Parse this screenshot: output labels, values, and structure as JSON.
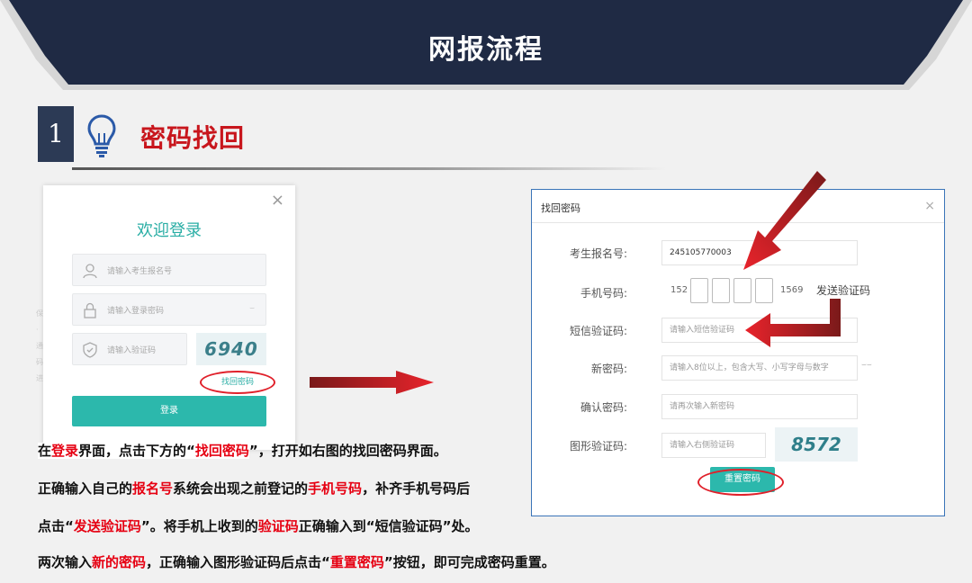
{
  "header": {
    "title": "网报流程"
  },
  "step": {
    "number": "1",
    "title": "密码找回"
  },
  "login_dialog": {
    "close": "×",
    "title": "欢迎登录",
    "id_placeholder": "请输入考生报名号",
    "password_placeholder": "请输入登录密码",
    "captcha_placeholder": "请输入验证码",
    "captcha_image": "6940",
    "forgot_link": "找回密码",
    "login_button": "登录"
  },
  "recover_dialog": {
    "title": "找回密码",
    "close": "×",
    "labels": {
      "reg_no": "考生报名号:",
      "phone": "手机号码:",
      "sms": "短信验证码:",
      "new_pwd": "新密码:",
      "confirm_pwd": "确认密码:",
      "captcha": "图形验证码:"
    },
    "reg_no_value": "245105770003",
    "phone_prefix": "152",
    "phone_suffix": "1569",
    "send_code": "发送验证码",
    "sms_placeholder": "请输入短信验证码",
    "new_pwd_placeholder": "请输入8位以上，包含大写、小写字母与数字",
    "confirm_placeholder": "请再次输入新密码",
    "captcha_placeholder": "请输入右侧验证码",
    "captcha_image": "8572",
    "reset_button": "重置密码"
  },
  "instructions": {
    "l1": [
      "在",
      "登录",
      "界面，点击下方的“",
      "找回密码",
      "”，打开如右图的找回密码界面。"
    ],
    "l2": [
      "正确输入自己的",
      "报名号",
      "系统会出现之前登记的",
      "手机号码",
      "，补齐手机号码后"
    ],
    "l3": [
      "点击“",
      "发送验证码",
      "”。将手机上收到的",
      "验证码",
      "正确输入到“短信验证码”处。"
    ],
    "l4": [
      "两次输入",
      "新的密码",
      "，正确输入图形验证码后点击“",
      "重置密码",
      "”按钮，即可完成密码重置。"
    ]
  },
  "colors": {
    "banner": "#1f2a44",
    "accent_red": "#e60012",
    "teal": "#2cb8ac",
    "step_box": "#2c3a55"
  }
}
